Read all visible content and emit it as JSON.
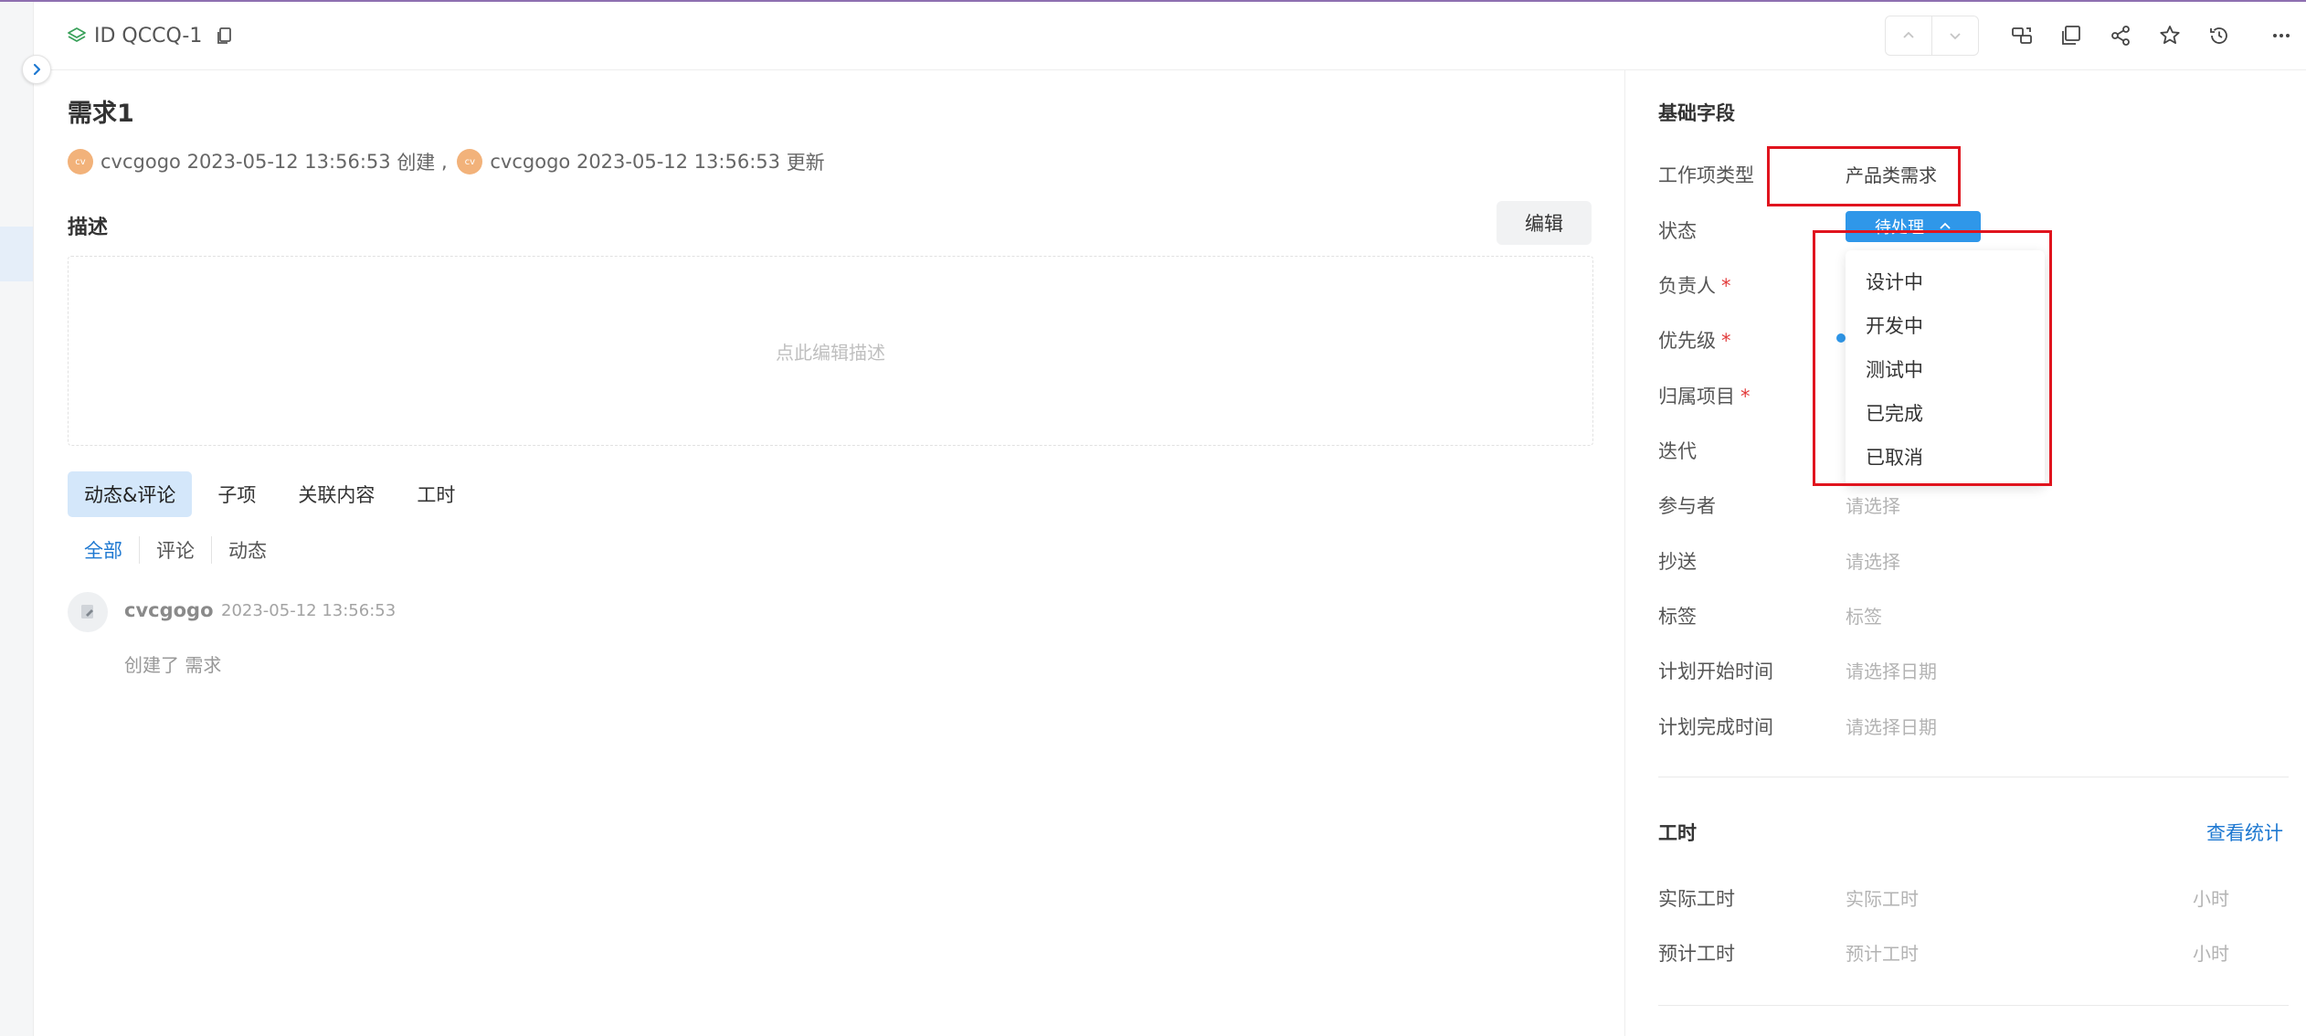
{
  "header": {
    "id_text": "ID QCCQ-1",
    "icons": [
      "layers-icon",
      "copy-icon",
      "chevron-up-icon",
      "chevron-down-icon",
      "sync-icon",
      "window-icon",
      "share-icon",
      "star-icon",
      "history-icon",
      "more-icon"
    ]
  },
  "sidebar": {
    "expand_icon": "chevron-right-icon"
  },
  "item": {
    "title": "需求1",
    "meta": {
      "avatar_text": "cv",
      "creator": "cvcgogo",
      "created_at": "2023-05-12 13:56:53",
      "created_suffix": "创建",
      "separator": ",",
      "updater": "cvcgogo",
      "updated_at": "2023-05-12 13:56:53",
      "updated_suffix": "更新"
    }
  },
  "description": {
    "label": "描述",
    "edit_label": "编辑",
    "placeholder": "点此编辑描述"
  },
  "tabs": [
    {
      "label": "动态&评论",
      "active": true
    },
    {
      "label": "子项"
    },
    {
      "label": "关联内容"
    },
    {
      "label": "工时"
    }
  ],
  "subtabs": [
    {
      "label": "全部",
      "active": true
    },
    {
      "label": "评论"
    },
    {
      "label": "动态"
    }
  ],
  "activity": {
    "user": "cvcgogo",
    "time": "2023-05-12 13:56:53",
    "text": "创建了 需求"
  },
  "basic_fields": {
    "title": "基础字段",
    "work_type": {
      "label": "工作项类型",
      "value": "产品类需求"
    },
    "status": {
      "label": "状态",
      "value": "待处理"
    },
    "assignee": {
      "label": "负责人",
      "required_mark": "*"
    },
    "priority": {
      "label": "优先级",
      "required_mark": "*"
    },
    "project": {
      "label": "归属项目",
      "required_mark": "*"
    },
    "iteration": {
      "label": "迭代"
    },
    "participants": {
      "label": "参与者",
      "placeholder": "请选择"
    },
    "cc": {
      "label": "抄送",
      "placeholder": "请选择"
    },
    "tags": {
      "label": "标签",
      "placeholder": "标签"
    },
    "plan_start": {
      "label": "计划开始时间",
      "placeholder": "请选择日期"
    },
    "plan_end": {
      "label": "计划完成时间",
      "placeholder": "请选择日期"
    }
  },
  "worktime": {
    "title": "工时",
    "view_stats": "查看统计",
    "actual": {
      "label": "实际工时",
      "placeholder": "实际工时",
      "unit": "小时"
    },
    "estimated": {
      "label": "预计工时",
      "placeholder": "预计工时",
      "unit": "小时"
    }
  },
  "status_dropdown": {
    "options": [
      "设计中",
      "开发中",
      "测试中",
      "已完成",
      "已取消"
    ]
  },
  "colors": {
    "accent": "#1e78d1",
    "status_blue": "#2f97e9",
    "highlight_red": "#e0141e",
    "active_tab_bg": "#d4e7fa"
  }
}
